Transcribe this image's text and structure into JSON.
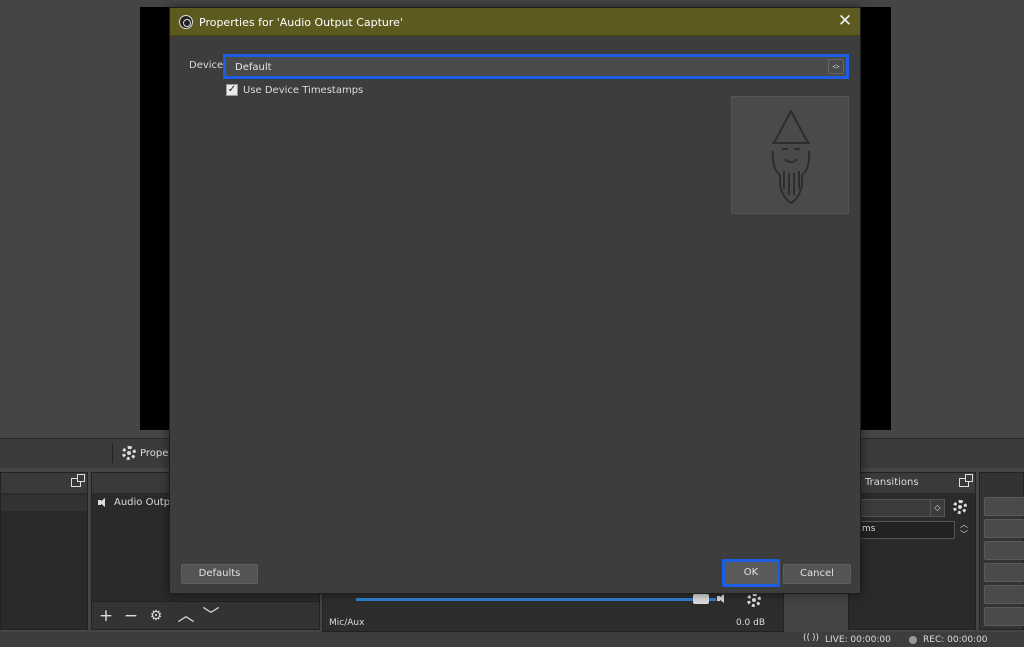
{
  "main": {
    "context_bar": {
      "properties_label": "Prope"
    },
    "sources": {
      "items": [
        {
          "label": "Audio Outp"
        }
      ],
      "tools": [
        "+",
        "−",
        "⚙",
        "︿",
        "﹀"
      ]
    },
    "mixer": {
      "channel_name": "Mic/Aux",
      "level": "0.0 dB"
    },
    "transitions": {
      "title": "Transitions",
      "duration_label": "ms"
    },
    "status": {
      "live": "LIVE: 00:00:00",
      "rec": "REC: 00:00:00"
    }
  },
  "dialog": {
    "title": "Properties for 'Audio Output Capture'",
    "close_glyph": "✕",
    "device_label": "Device",
    "device_value": "Default",
    "use_timestamps_label": "Use Device Timestamps",
    "use_timestamps_checked": true,
    "defaults_button": "Defaults",
    "ok_button": "OK",
    "cancel_button": "Cancel"
  },
  "colors": {
    "titlebar": "#5c5a1f",
    "highlight": "#1a5fe3",
    "dialog_bg": "#3d3d3d"
  }
}
